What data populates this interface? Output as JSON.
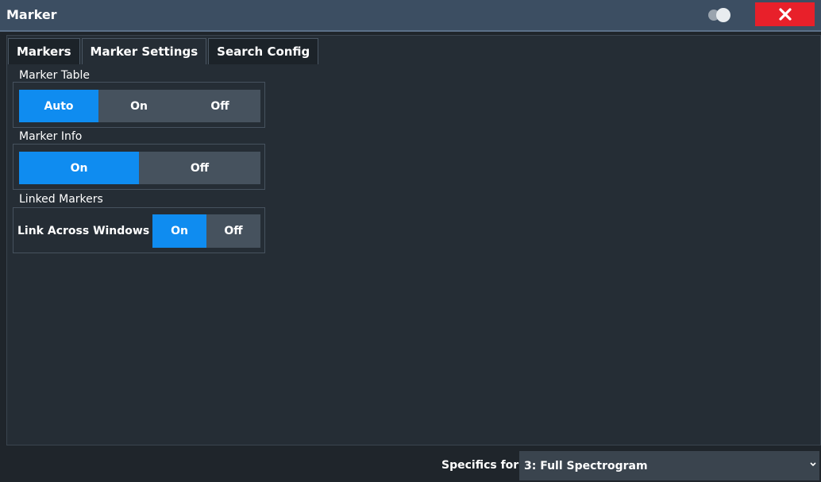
{
  "window": {
    "title": "Marker"
  },
  "tabs": [
    {
      "label": "Markers",
      "active": false
    },
    {
      "label": "Marker Settings",
      "active": true
    },
    {
      "label": "Search Config",
      "active": false
    }
  ],
  "marker_table": {
    "label": "Marker Table",
    "options": [
      "Auto",
      "On",
      "Off"
    ],
    "selected": "Auto"
  },
  "marker_info": {
    "label": "Marker Info",
    "options": [
      "On",
      "Off"
    ],
    "selected": "On"
  },
  "linked_markers": {
    "label": "Linked Markers",
    "link_label": "Link Across Windows",
    "options": [
      "On",
      "Off"
    ],
    "selected": "On"
  },
  "specifics": {
    "label": "Specifics for",
    "value": "3: Full Spectrogram"
  },
  "colors": {
    "titlebar": "#3c4e62",
    "accent": "#0f8cf0",
    "close": "#e8202a",
    "panel": "#252d35"
  },
  "icons": {
    "toggle": "toggle-icon",
    "close": "close-icon",
    "dropdown": "chevron-down-icon"
  }
}
